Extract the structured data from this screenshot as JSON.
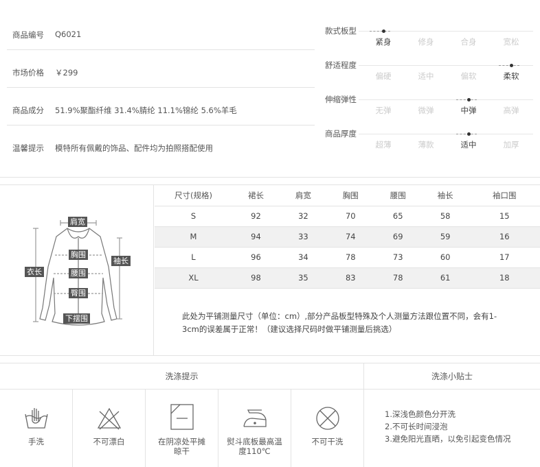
{
  "product": {
    "rows": [
      {
        "label": "商品编号",
        "value": "Q6021"
      },
      {
        "label": "市场价格",
        "value": "￥299"
      },
      {
        "label": "商品成分",
        "value": "51.9%聚酯纤维 31.4%腈纶 11.1%锦纶 5.6%羊毛"
      },
      {
        "label": "温馨提示",
        "value": "模特所有佩戴的饰品、配件均为拍照搭配使用"
      }
    ]
  },
  "attributes": [
    {
      "label": "款式板型",
      "options": [
        "紧身",
        "修身",
        "合身",
        "宽松"
      ],
      "selected_index": 0
    },
    {
      "label": "舒适程度",
      "options": [
        "偏硬",
        "适中",
        "偏软",
        "柔软"
      ],
      "selected_index": 3
    },
    {
      "label": "伸缩弹性",
      "options": [
        "无弹",
        "微弹",
        "中弹",
        "高弹"
      ],
      "selected_index": 2
    },
    {
      "label": "商品厚度",
      "options": [
        "超薄",
        "薄款",
        "适中",
        "加厚"
      ],
      "selected_index": 2
    }
  ],
  "diagram": {
    "labels": {
      "shoulder": "肩宽",
      "chest": "胸围",
      "waist": "腰围",
      "hip": "臀围",
      "hem": "下摆围",
      "length": "衣长",
      "sleeve": "袖长"
    }
  },
  "size_table": {
    "headers": [
      "尺寸(规格)",
      "裙长",
      "肩宽",
      "胸围",
      "腰围",
      "袖长",
      "袖口围"
    ],
    "rows": [
      [
        "S",
        "92",
        "32",
        "70",
        "65",
        "58",
        "15"
      ],
      [
        "M",
        "94",
        "33",
        "74",
        "69",
        "59",
        "16"
      ],
      [
        "L",
        "96",
        "34",
        "78",
        "73",
        "60",
        "17"
      ],
      [
        "XL",
        "98",
        "35",
        "83",
        "78",
        "61",
        "18"
      ]
    ],
    "note_line1": "此处为平铺测量尺寸（单位：cm）,部分产品板型特殊及个人测量方法跟位置不同，会有1-",
    "note_line2": "3cm的误差属于正常！（建议选择尺码时做平铺测量后挑选）"
  },
  "wash": {
    "title": "洗涤提示",
    "items": [
      {
        "icon": "hand-wash-icon",
        "label": "手洗"
      },
      {
        "icon": "no-bleach-icon",
        "label": "不可漂白"
      },
      {
        "icon": "dry-flat-shade-icon",
        "label": "在阴凉处平摊晾干"
      },
      {
        "icon": "iron-low-temp-icon",
        "label": "熨斗底板最高温度110℃"
      },
      {
        "icon": "no-dry-clean-icon",
        "label": "不可干洗"
      }
    ]
  },
  "tips": {
    "title": "洗涤小贴士",
    "lines": [
      "1.深浅色颜色分开洗",
      "2.不可长时间浸泡",
      "3.避免阳光直晒，以免引起变色情况"
    ]
  }
}
